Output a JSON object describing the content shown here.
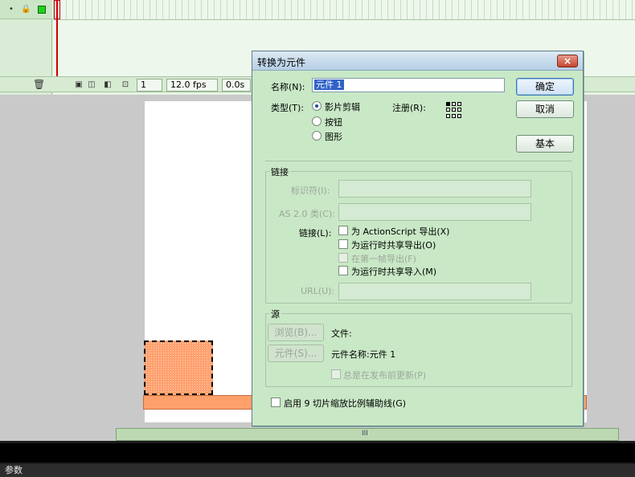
{
  "timeline": {
    "current_frame": "1",
    "fps": "12.0 fps",
    "elapsed": "0.0s"
  },
  "dialog": {
    "title": "转换为元件",
    "close_label": "×",
    "name_label": "名称(N):",
    "name_value": "元件 1",
    "ok_label": "确定",
    "cancel_label": "取消",
    "basic_label": "基本",
    "type_label": "类型(T):",
    "type_options": [
      "影片剪辑",
      "按钮",
      "图形"
    ],
    "selected_type": "影片剪辑",
    "registration_label": "注册(R):",
    "linkage": {
      "title": "链接",
      "identifier_label": "标识符(I):",
      "as_class_label": "AS 2.0 类(C):",
      "linkage_label": "链接(L):",
      "options": [
        "为 ActionScript 导出(X)",
        "为运行时共享导出(O)",
        "在第一帧导出(F)",
        "为运行时共享导入(M)"
      ],
      "url_label": "URL(U):"
    },
    "source": {
      "title": "源",
      "browse_label": "浏览(B)...",
      "file_label": "文件:",
      "symbol_button_label": "元件(S)...",
      "symbol_name_label": "元件名称:元件 1",
      "always_update_label": "总是在发布前更新(P)"
    },
    "nine_slice_label": "启用 9 切片缩放比例辅助线(G)"
  },
  "scrollbar": {
    "grip": "III"
  },
  "params_bar": {
    "label": "参数"
  },
  "colors": {
    "dialog_bg": "#c9e8c6",
    "shape_fill": "#ffa16f",
    "timeline_bg": "#e6f4e2"
  }
}
